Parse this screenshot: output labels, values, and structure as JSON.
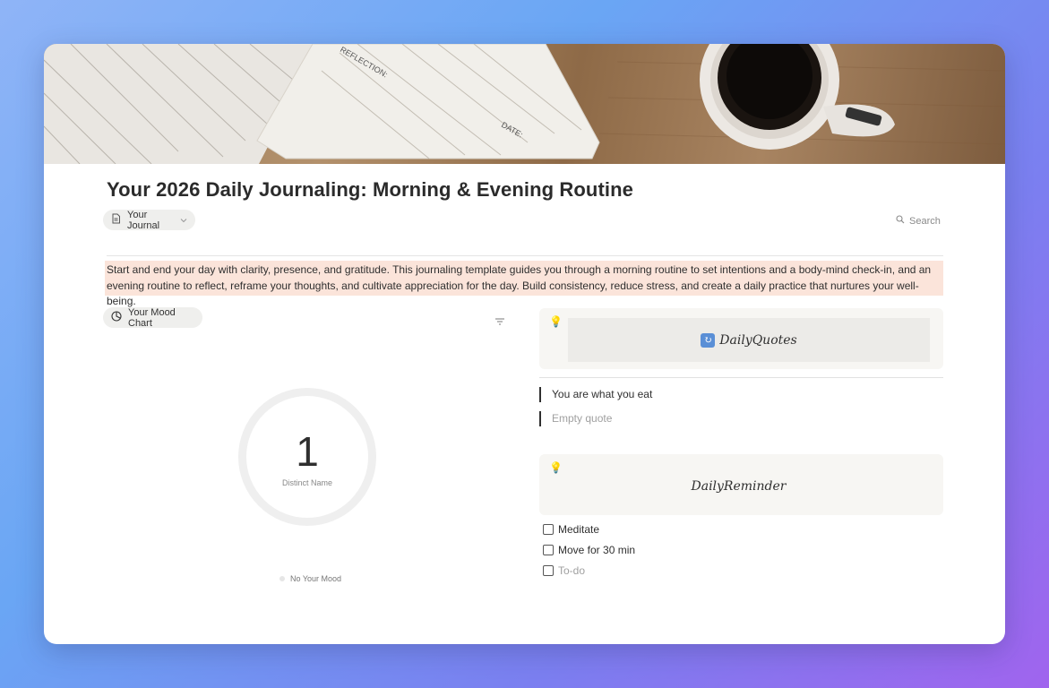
{
  "page": {
    "title": "Your 2026 Daily Journaling: Morning & Evening Routine",
    "cover_text": {
      "reflection": "REFLECTION:",
      "date": "DATE:"
    }
  },
  "header": {
    "journal_pill": {
      "icon": "page-icon",
      "label": "Your Journal",
      "chevron": "chevron-down-icon"
    },
    "search": {
      "icon": "search-icon",
      "label": "Search"
    }
  },
  "callout": {
    "text": "Start and end your day with clarity, presence, and gratitude. This journaling template guides you through a morning routine to set intentions and a body-mind check-in, and an evening routine to reflect, reframe your thoughts, and cultivate appreciation for the day. Build consistency, reduce stress, and create a daily practice that nurtures your well-being.",
    "bg_color": "#fbe4da"
  },
  "mood_chart": {
    "pill_label": "Your Mood Chart",
    "pill_icon": "chart-icon",
    "filter_icon": "filter-icon",
    "center_value": "1",
    "center_label": "Distinct Name",
    "legend": "No Your Mood"
  },
  "chart_data": {
    "type": "pie",
    "categories": [
      "No Your Mood"
    ],
    "values": [
      1
    ],
    "center_value": 1,
    "center_label": "Distinct Name",
    "colors": [
      "#efefef"
    ]
  },
  "quotes": {
    "icon": "lightbulb-icon",
    "title_icon": "refresh-icon",
    "title": "DailyQuotes",
    "items": [
      {
        "text": "You are what you eat"
      },
      {
        "text": "Empty quote"
      }
    ]
  },
  "reminder": {
    "icon": "lightbulb-icon",
    "title": "DailyReminder",
    "items": [
      {
        "label": "Meditate",
        "checked": false
      },
      {
        "label": "Move for 30 min",
        "checked": false
      },
      {
        "label": "To-do",
        "checked": false
      }
    ]
  }
}
